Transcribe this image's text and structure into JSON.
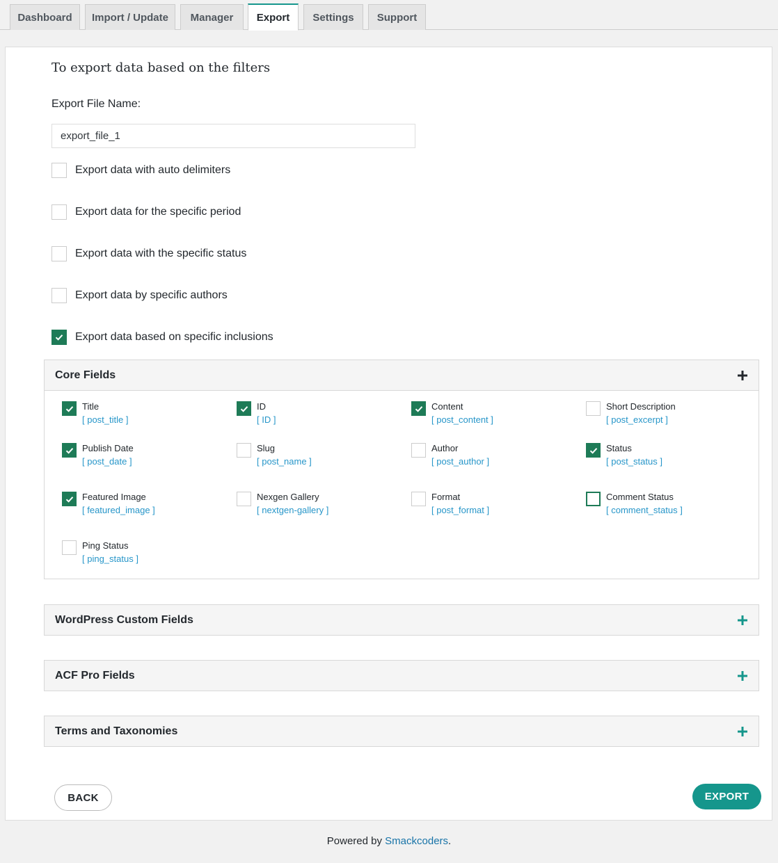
{
  "tabs": [
    {
      "label": "Dashboard",
      "active": false
    },
    {
      "label": "Import / Update",
      "active": false
    },
    {
      "label": "Manager",
      "active": false
    },
    {
      "label": "Export",
      "active": true
    },
    {
      "label": "Settings",
      "active": false
    },
    {
      "label": "Support",
      "active": false
    }
  ],
  "colors": {
    "accent": "#15968c",
    "checkbox_checked": "#1e7b57",
    "field_key": "#2796c9",
    "link": "#1874a8"
  },
  "export": {
    "heading": "To export data based on the filters",
    "file_name_label": "Export File Name:",
    "file_name_value": "export_file_1",
    "options": [
      {
        "label": "Export data with auto delimiters",
        "checked": false
      },
      {
        "label": "Export data for the specific period",
        "checked": false
      },
      {
        "label": "Export data with the specific status",
        "checked": false
      },
      {
        "label": "Export data by specific authors",
        "checked": false
      },
      {
        "label": "Export data based on specific inclusions",
        "checked": true
      }
    ]
  },
  "core_fields": {
    "title": "Core Fields",
    "icon": "plus-icon",
    "fields": [
      {
        "name": "Title",
        "key": "[ post_title ]",
        "checked": true
      },
      {
        "name": "ID",
        "key": "[ ID ]",
        "checked": true
      },
      {
        "name": "Content",
        "key": "[ post_content ]",
        "checked": true
      },
      {
        "name": "Short Description",
        "key": "[ post_excerpt ]",
        "checked": false
      },
      {
        "name": "Publish Date",
        "key": "[ post_date ]",
        "checked": true
      },
      {
        "name": "Slug",
        "key": "[ post_name ]",
        "checked": false
      },
      {
        "name": "Author",
        "key": "[ post_author ]",
        "checked": false
      },
      {
        "name": "Status",
        "key": "[ post_status ]",
        "checked": true
      },
      {
        "name": "Featured Image",
        "key": "[ featured_image ]",
        "checked": true
      },
      {
        "name": "Nexgen Gallery",
        "key": "[ nextgen-gallery ]",
        "checked": false
      },
      {
        "name": "Format",
        "key": "[ post_format ]",
        "checked": false
      },
      {
        "name": "Comment Status",
        "key": "[ comment_status ]",
        "checked": false,
        "focused": true
      },
      {
        "name": "Ping Status",
        "key": "[ ping_status ]",
        "checked": false
      }
    ]
  },
  "sections": [
    {
      "title": "WordPress Custom Fields",
      "icon": "plus-icon"
    },
    {
      "title": "ACF Pro Fields",
      "icon": "plus-icon"
    },
    {
      "title": "Terms and Taxonomies",
      "icon": "plus-icon"
    }
  ],
  "buttons": {
    "back": "BACK",
    "export": "EXPORT"
  },
  "footer": {
    "prefix": "Powered by ",
    "link": "Smackcoders",
    "suffix": "."
  }
}
